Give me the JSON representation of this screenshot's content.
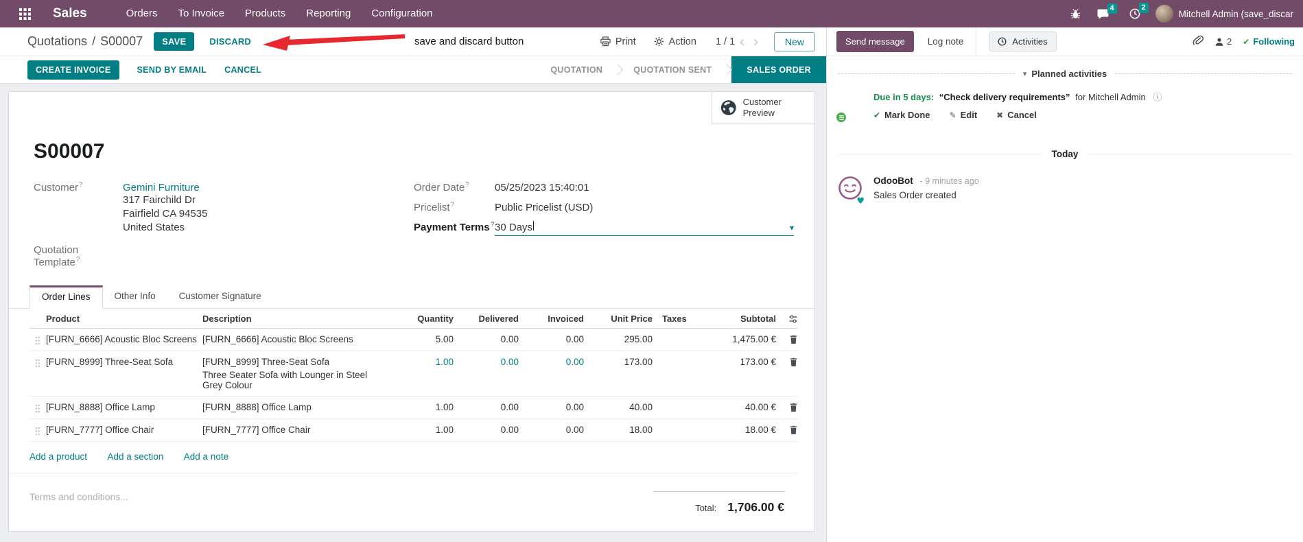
{
  "navbar": {
    "brand": "Sales",
    "menus": [
      "Orders",
      "To Invoice",
      "Products",
      "Reporting",
      "Configuration"
    ],
    "message_badge": "4",
    "activity_badge": "2",
    "user_name": "Mitchell Admin (save_discar"
  },
  "breadcrumb": {
    "parent": "Quotations",
    "separator": "/",
    "current": "S00007"
  },
  "header_actions": {
    "save": "SAVE",
    "discard": "DISCARD",
    "print": "Print",
    "action": "Action",
    "pager": "1 / 1",
    "new": "New"
  },
  "annotation": {
    "text": "save and discard button"
  },
  "statusbar": {
    "buttons": [
      {
        "label": "CREATE INVOICE"
      },
      {
        "label": "SEND BY EMAIL"
      },
      {
        "label": "CANCEL"
      }
    ],
    "states": [
      {
        "label": "QUOTATION"
      },
      {
        "label": "QUOTATION SENT"
      },
      {
        "label": "SALES ORDER"
      }
    ]
  },
  "form": {
    "title": "S00007",
    "customer_preview": "Customer Preview",
    "fields": {
      "customer_label": "Customer",
      "customer_name": "Gemini Furniture",
      "address_line1": "317 Fairchild Dr",
      "address_line2": "Fairfield CA 94535",
      "address_line3": "United States",
      "quotation_template_label": "Quotation Template",
      "order_date_label": "Order Date",
      "order_date_value": "05/25/2023 15:40:01",
      "pricelist_label": "Pricelist",
      "pricelist_value": "Public Pricelist (USD)",
      "payment_terms_label": "Payment Terms",
      "payment_terms_value": "30 Days",
      "help_marker": "?"
    },
    "tabs": [
      {
        "label": "Order Lines"
      },
      {
        "label": "Other Info"
      },
      {
        "label": "Customer Signature"
      }
    ],
    "table": {
      "columns": [
        "Product",
        "Description",
        "Quantity",
        "Delivered",
        "Invoiced",
        "Unit Price",
        "Taxes",
        "Subtotal"
      ],
      "rows": [
        {
          "product": "[FURN_6666] Acoustic Bloc Screens",
          "description": "[FURN_6666] Acoustic Bloc Screens",
          "description2": "",
          "quantity": "5.00",
          "delivered": "0.00",
          "invoiced": "0.00",
          "unit_price": "295.00",
          "taxes": "",
          "subtotal": "1,475.00 €"
        },
        {
          "product": "[FURN_8999] Three-Seat Sofa",
          "description": "[FURN_8999] Three-Seat Sofa",
          "description2": "Three Seater Sofa with Lounger in Steel Grey Colour",
          "quantity": "1.00",
          "delivered": "0.00",
          "invoiced": "0.00",
          "unit_price": "173.00",
          "taxes": "",
          "subtotal": "173.00 €"
        },
        {
          "product": "[FURN_8888] Office Lamp",
          "description": "[FURN_8888] Office Lamp",
          "description2": "",
          "quantity": "1.00",
          "delivered": "0.00",
          "invoiced": "0.00",
          "unit_price": "40.00",
          "taxes": "",
          "subtotal": "40.00 €"
        },
        {
          "product": "[FURN_7777] Office Chair",
          "description": "[FURN_7777] Office Chair",
          "description2": "",
          "quantity": "1.00",
          "delivered": "0.00",
          "invoiced": "0.00",
          "unit_price": "18.00",
          "taxes": "",
          "subtotal": "18.00 €"
        }
      ],
      "footer_links": [
        "Add a product",
        "Add a section",
        "Add a note"
      ]
    },
    "terms_placeholder": "Terms and conditions...",
    "total_label": "Total:",
    "total_value": "1,706.00 €"
  },
  "chatter": {
    "send_message": "Send message",
    "log_note": "Log note",
    "activities": "Activities",
    "follower_count": "2",
    "following": "Following",
    "planned_title": "Planned activities",
    "activity": {
      "due": "Due in 5 days:",
      "task": "“Check delivery requirements”",
      "assignee": "for Mitchell Admin",
      "mark_done": "Mark Done",
      "edit": "Edit",
      "cancel": "Cancel"
    },
    "today_label": "Today",
    "message": {
      "author": "OdooBot",
      "time": "- 9 minutes ago",
      "body": "Sales Order created"
    }
  },
  "icons": {
    "caret_down": "▾",
    "chevron_left": "‹",
    "chevron_right": "›",
    "check": "✔",
    "pencil": "✎",
    "cross": "✖",
    "info": "ⓘ",
    "heart": "♥"
  },
  "colors": {
    "accent_teal": "#017e84",
    "brand_purple": "#714b67",
    "success_green": "#188f4b",
    "annotation_red": "#e8282f",
    "badge_teal": "#089690"
  }
}
